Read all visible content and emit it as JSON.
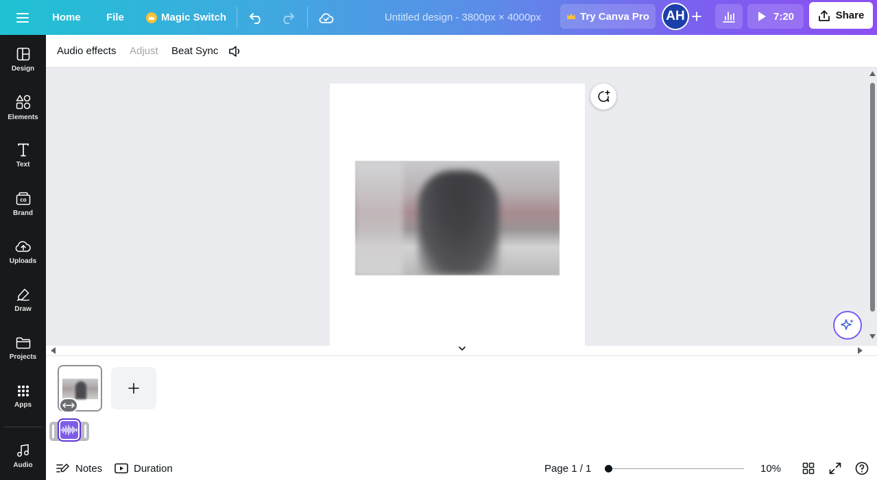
{
  "topbar": {
    "home_label": "Home",
    "file_label": "File",
    "magic_switch_label": "Magic Switch",
    "doc_title": "Untitled design - 3800px × 4000px",
    "try_pro_label": "Try Canva Pro",
    "avatar_initials": "AH",
    "play_time": "7:20",
    "share_label": "Share"
  },
  "sidebar": {
    "items": [
      {
        "label": "Design",
        "icon": "design-icon"
      },
      {
        "label": "Elements",
        "icon": "elements-icon"
      },
      {
        "label": "Text",
        "icon": "text-icon"
      },
      {
        "label": "Brand",
        "icon": "brand-icon"
      },
      {
        "label": "Uploads",
        "icon": "uploads-icon"
      },
      {
        "label": "Draw",
        "icon": "draw-icon"
      },
      {
        "label": "Projects",
        "icon": "projects-icon"
      },
      {
        "label": "Apps",
        "icon": "apps-icon"
      },
      {
        "label": "Audio",
        "icon": "audio-icon"
      }
    ]
  },
  "context_toolbar": {
    "audio_effects_label": "Audio effects",
    "adjust_label": "Adjust",
    "beat_sync_label": "Beat Sync"
  },
  "footer": {
    "notes_label": "Notes",
    "duration_label": "Duration",
    "page_indicator": "Page 1 / 1",
    "zoom_level": "10%"
  },
  "colors": {
    "sidebar_bg": "#18191b",
    "accent_purple": "#7d5ff0",
    "brand_gradient_start": "#1fc2d3",
    "brand_gradient_end": "#8b4ff2"
  }
}
